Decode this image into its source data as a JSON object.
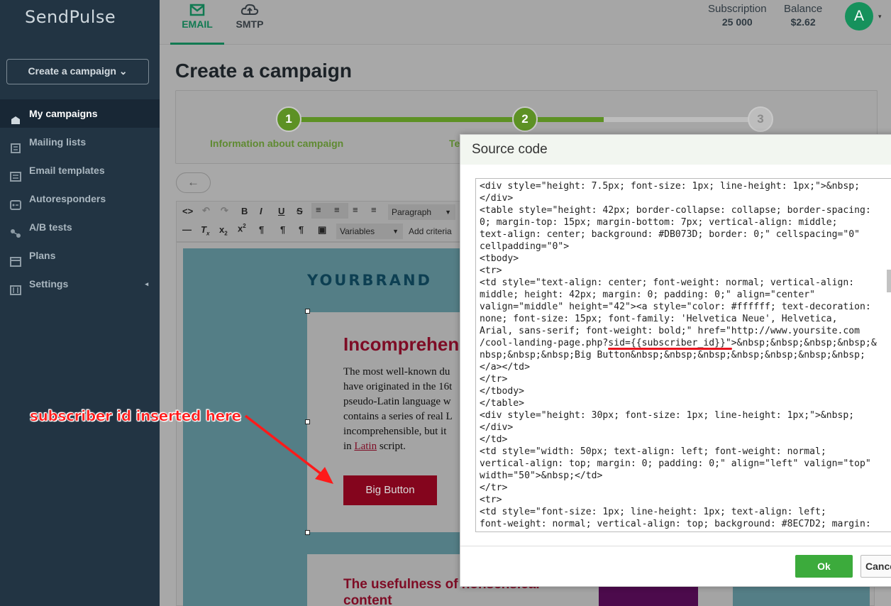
{
  "app": {
    "logo": "SendPulse",
    "create_button": "Create a campaign ⌄"
  },
  "sidebar": {
    "items": [
      {
        "label": "My campaigns",
        "icon": "campaign-icon"
      },
      {
        "label": "Mailing lists",
        "icon": "list-icon"
      },
      {
        "label": "Email templates",
        "icon": "template-icon"
      },
      {
        "label": "Autoresponders",
        "icon": "autoresponder-icon"
      },
      {
        "label": "A/B tests",
        "icon": "ab-test-icon"
      },
      {
        "label": "Plans",
        "icon": "plans-icon"
      },
      {
        "label": "Settings",
        "icon": "settings-icon"
      }
    ],
    "settings_arrow": "◂"
  },
  "topbar": {
    "tabs": [
      {
        "label": "EMAIL",
        "icon": "envelope-icon"
      },
      {
        "label": "SMTP",
        "icon": "cloud-icon"
      }
    ],
    "subscription_label": "Subscription",
    "subscription_value": "25 000",
    "balance_label": "Balance",
    "balance_value": "$2.62",
    "avatar_letter": "A"
  },
  "main": {
    "title": "Create a campaign",
    "steps": [
      {
        "num": "1",
        "label": "Information about campaign"
      },
      {
        "num": "2",
        "label": "Te"
      },
      {
        "num": "3",
        "label": ""
      }
    ],
    "back_arrow": "←"
  },
  "toolbar": {
    "format_select": "Paragraph",
    "variables_select": "Variables",
    "add_criteria": "Add criteria"
  },
  "email": {
    "brand": "YOURBRAND",
    "heading": "Incomprehen",
    "paragraph_lines": [
      "The most well-known du",
      "have originated in the 16t",
      "pseudo-Latin language w",
      "contains a series of real L",
      "incomprehensible, but it"
    ],
    "paragraph_last_prefix": "in ",
    "paragraph_link": "Latin",
    "paragraph_last_suffix": " script.",
    "button": "Big Button",
    "heading2": "The usefulness of nonsensical content"
  },
  "annotation": {
    "text": "subscriber id inserted here"
  },
  "modal": {
    "title": "Source code",
    "code": "<div style=\"height: 7.5px; font-size: 1px; line-height: 1px;\">&nbsp;\n</div>\n<table style=\"height: 42px; border-collapse: collapse; border-spacing:\n0; margin-top: 15px; margin-bottom: 7px; vertical-align: middle;\ntext-align: center; background: #DB073D; border: 0;\" cellspacing=\"0\"\ncellpadding=\"0\">\n<tbody>\n<tr>\n<td style=\"text-align: center; font-weight: normal; vertical-align:\nmiddle; height: 42px; margin: 0; padding: 0;\" align=\"center\"\nvalign=\"middle\" height=\"42\"><a style=\"color: #ffffff; text-decoration:\nnone; font-size: 15px; font-family: 'Helvetica Neue', Helvetica,\nArial, sans-serif; font-weight: bold;\" href=\"http://www.yoursite.com\n/cool-landing-page.php?sid={{subscriber_id}}\">&nbsp;&nbsp;&nbsp;&nbsp;&\nnbsp;&nbsp;&nbsp;Big Button&nbsp;&nbsp;&nbsp;&nbsp;&nbsp;&nbsp;&nbsp;\n</a></td>\n</tr>\n</tbody>\n</table>\n<div style=\"height: 30px; font-size: 1px; line-height: 1px;\">&nbsp;\n</div>\n</td>\n<td style=\"width: 50px; text-align: left; font-weight: normal;\nvertical-align: top; margin: 0; padding: 0;\" align=\"left\" valign=\"top\"\nwidth=\"50\">&nbsp;</td>\n</tr>\n<tr>\n<td style=\"font-size: 1px; line-height: 1px; text-align: left;\nfont-weight: normal; vertical-align: top; background: #8EC7D2; margin:",
    "ok": "Ok",
    "cancel": "Cance"
  },
  "colors": {
    "sidebar_bg": "#223443",
    "accent_green": "#117a52",
    "ok_green": "#3cab3c",
    "button_red": "#84051d",
    "annotation_red": "#ff1a1a"
  }
}
